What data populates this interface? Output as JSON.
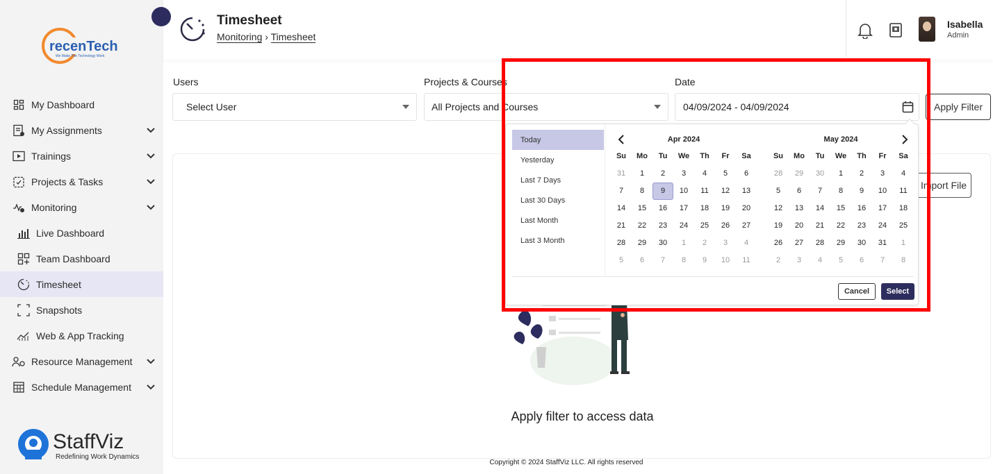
{
  "sidebar": {
    "brand_logo": "recenTech",
    "brand_tagline": "We Make The Technology Work",
    "items": [
      {
        "label": "My Dashboard",
        "icon": "dashboard-icon",
        "expandable": false
      },
      {
        "label": "My Assignments",
        "icon": "assignments-icon",
        "expandable": true
      },
      {
        "label": "Trainings",
        "icon": "play-icon",
        "expandable": true
      },
      {
        "label": "Projects & Tasks",
        "icon": "clipboard-icon",
        "expandable": true
      },
      {
        "label": "Monitoring",
        "icon": "monitoring-icon",
        "expandable": true
      },
      {
        "label": "Live Dashboard",
        "icon": "bar-chart-icon",
        "sub": true
      },
      {
        "label": "Team Dashboard",
        "icon": "grid-add-icon",
        "sub": true
      },
      {
        "label": "Timesheet",
        "icon": "timer-icon",
        "sub": true,
        "active": true
      },
      {
        "label": "Snapshots",
        "icon": "frame-icon",
        "sub": true
      },
      {
        "label": "Web & App Tracking",
        "icon": "trend-icon",
        "sub": true
      },
      {
        "label": "Resource Management",
        "icon": "resource-icon",
        "expandable": true
      },
      {
        "label": "Schedule Management",
        "icon": "calendar-grid-icon",
        "expandable": true
      }
    ],
    "footer_brand": "StaffViz",
    "footer_tagline": "Redefining Work Dynamics"
  },
  "header": {
    "title": "Timesheet",
    "breadcrumb": [
      "Monitoring",
      "Timesheet"
    ],
    "user_name": "Isabella",
    "user_role": "Admin"
  },
  "filters": {
    "users_label": "Users",
    "users_value": "Select User",
    "projects_label": "Projects & Courses",
    "projects_value": "All Projects and Courses",
    "date_label": "Date",
    "date_value": "04/09/2024 - 04/09/2024",
    "apply_label": "Apply Filter"
  },
  "content": {
    "import_label": "Import File",
    "empty_message": "Apply filter to access data"
  },
  "picker": {
    "ranges": [
      "Today",
      "Yesterday",
      "Last 7 Days",
      "Last 30 Days",
      "Last Month",
      "Last 3 Month"
    ],
    "active_range": "Today",
    "weekdays": [
      "Su",
      "Mo",
      "Tu",
      "We",
      "Th",
      "Fr",
      "Sa"
    ],
    "left_month": {
      "title": "Apr 2024",
      "days": [
        "31",
        "1",
        "2",
        "3",
        "4",
        "5",
        "6",
        "7",
        "8",
        "9",
        "10",
        "11",
        "12",
        "13",
        "14",
        "15",
        "16",
        "17",
        "18",
        "19",
        "20",
        "21",
        "22",
        "23",
        "24",
        "25",
        "26",
        "27",
        "28",
        "29",
        "30",
        "1",
        "2",
        "3",
        "4",
        "5",
        "6",
        "7",
        "8",
        "9",
        "10",
        "11"
      ],
      "first_in_month": 1,
      "last_in_month": 30,
      "selected": "9"
    },
    "right_month": {
      "title": "May 2024",
      "days": [
        "28",
        "29",
        "30",
        "1",
        "2",
        "3",
        "4",
        "5",
        "6",
        "7",
        "8",
        "9",
        "10",
        "11",
        "12",
        "13",
        "14",
        "15",
        "16",
        "17",
        "18",
        "19",
        "20",
        "21",
        "22",
        "23",
        "24",
        "25",
        "26",
        "27",
        "28",
        "29",
        "30",
        "31",
        "1",
        "2",
        "3",
        "4",
        "5",
        "6",
        "7",
        "8"
      ],
      "first_in_month": 3,
      "last_in_month": 33
    },
    "cancel_label": "Cancel",
    "select_label": "Select"
  },
  "footer": {
    "copyright": "Copyright © 2024 StaffViz LLC. All rights reserved"
  },
  "colors": {
    "accent": "#2e2e5e",
    "active_bg": "#e6e6f5",
    "selection": "#c7c7e6",
    "highlight": "#ff0000"
  }
}
